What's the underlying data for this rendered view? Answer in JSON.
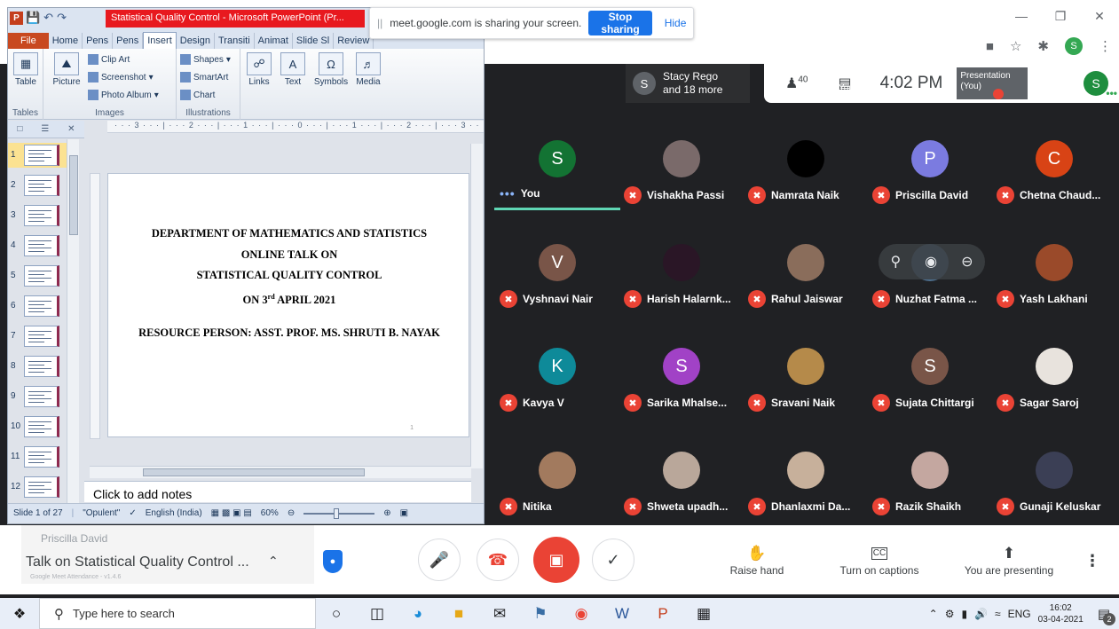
{
  "ppt": {
    "logo": "P",
    "title": "Statistical Quality Control - Microsoft PowerPoint (Pr...",
    "tabs": [
      "File",
      "Home",
      "Pens",
      "Pens",
      "Insert",
      "Design",
      "Transiti",
      "Animat",
      "Slide Sl",
      "Review"
    ],
    "ribbon": {
      "table_label": "Table",
      "picture_label": "Picture",
      "clip_art": "Clip Art",
      "screenshot": "Screenshot",
      "photo_album": "Photo Album",
      "shapes": "Shapes",
      "smartart": "SmartArt",
      "chart": "Chart",
      "links": "Links",
      "text": "Text",
      "symbols": "Symbols",
      "media": "Media",
      "group_tables": "Tables",
      "group_images": "Images",
      "group_illustrations": "Illustrations"
    },
    "ruler": "· · · 3 · · · | · · · 2 · · · | · · · 1 · · · | · · · 0 · · · | · · · 1 · · · | · · · 2 · · · | · · · 3 · · · | · · 4",
    "thumbnails": [
      "1",
      "2",
      "3",
      "4",
      "5",
      "6",
      "7",
      "8",
      "9",
      "10",
      "11",
      "12"
    ],
    "selected_slide": 1,
    "slide": {
      "line1": "DEPARTMENT OF  MATHEMATICS AND STATISTICS",
      "line2": "ONLINE TALK ON",
      "line3": "STATISTICAL QUALITY CONTROL",
      "line4_prefix": "ON 3",
      "line4_sup": "rd",
      "line4_suffix": " APRIL 2021",
      "resource": "RESOURCE  PERSON: ASST.  PROF.  MS. SHRUTI B. NAYAK",
      "page": "1"
    },
    "notes_placeholder": "Click to add notes",
    "status": {
      "slide": "Slide 1 of 27",
      "theme": "\"Opulent\"",
      "language": "English (India)",
      "zoom": "60%"
    }
  },
  "chrome": {
    "sharing_text": "meet.google.com is sharing your screen.",
    "pause_glyph": "||",
    "stop_sharing": "Stop sharing",
    "hide": "Hide",
    "profile_initial": "S"
  },
  "meet": {
    "presenter": {
      "initial": "S",
      "line1": "Stacy Rego",
      "line2": "and 18 more"
    },
    "people_count": "40",
    "time": "4:02 PM",
    "presentation_label": "Presentation (You)",
    "self_label": "You",
    "self_initial": "S",
    "participants": [
      {
        "name": "You",
        "initial": "S",
        "color": "#137333",
        "muted": false
      },
      {
        "name": "Vishakha Passi",
        "initial": "",
        "color": "#7a6a6a",
        "muted": true
      },
      {
        "name": "Namrata Naik",
        "initial": "",
        "color": "#000000",
        "muted": true
      },
      {
        "name": "Priscilla David",
        "initial": "P",
        "color": "#7b7be0",
        "muted": true
      },
      {
        "name": "Chetna Chaud...",
        "initial": "C",
        "color": "#d84315",
        "muted": true
      },
      {
        "name": "Vyshnavi Nair",
        "initial": "V",
        "color": "#795548",
        "muted": true
      },
      {
        "name": "Harish Halarnk...",
        "initial": "",
        "color": "#2a1626",
        "muted": true
      },
      {
        "name": "Rahul Jaiswar",
        "initial": "",
        "color": "#8a6d5b",
        "muted": true
      },
      {
        "name": "Nuzhat Fatma ...",
        "initial": "",
        "color": "#4d6e8c",
        "muted": true
      },
      {
        "name": "Yash Lakhani",
        "initial": "",
        "color": "#9a4a2a",
        "muted": true
      },
      {
        "name": "Kavya V",
        "initial": "K",
        "color": "#0e8a99",
        "muted": true
      },
      {
        "name": "Sarika Mhalse...",
        "initial": "S",
        "color": "#a142c6",
        "muted": true
      },
      {
        "name": "Sravani Naik",
        "initial": "",
        "color": "#b58a4a",
        "muted": true
      },
      {
        "name": "Sujata Chittargi",
        "initial": "S",
        "color": "#795548",
        "muted": true
      },
      {
        "name": "Sagar Saroj",
        "initial": "",
        "color": "#e8e3dd",
        "muted": true
      },
      {
        "name": "Nitika",
        "initial": "",
        "color": "#a27a5e",
        "muted": true
      },
      {
        "name": "Shweta upadh...",
        "initial": "",
        "color": "#b9a79a",
        "muted": true
      },
      {
        "name": "Dhanlaxmi Da...",
        "initial": "",
        "color": "#c7b09b",
        "muted": true
      },
      {
        "name": "Razik Shaikh",
        "initial": "",
        "color": "#c4a7a0",
        "muted": true
      },
      {
        "name": "Gunaji Keluskar",
        "initial": "",
        "color": "#3b3f55",
        "muted": true
      }
    ],
    "meeting_title": "Talk on Statistical Quality Control ...",
    "ghost_name": "Priscilla David",
    "ghost_footer": "Google Meet Attendance - v1.4.6",
    "raise_hand": "Raise hand",
    "captions": "Turn on captions",
    "presenting": "You are presenting",
    "captions_icon": "CC"
  },
  "taskbar": {
    "search_placeholder": "Type here to search",
    "lang": "ENG",
    "time": "16:02",
    "date": "03-04-2021",
    "notifications": "2"
  },
  "colors": {
    "meet_bg": "#202124",
    "red": "#ea4335",
    "blue": "#1a73e8",
    "ppt_red": "#e8191f"
  }
}
